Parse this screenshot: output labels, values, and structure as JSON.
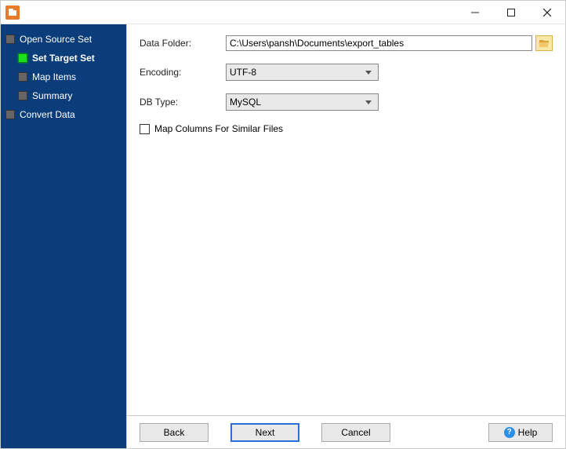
{
  "titlebar": {
    "title": ""
  },
  "sidebar": {
    "items": [
      {
        "label": "Open Source Set",
        "active": false,
        "indent": 0
      },
      {
        "label": "Set Target Set",
        "active": true,
        "indent": 1
      },
      {
        "label": "Map Items",
        "active": false,
        "indent": 1
      },
      {
        "label": "Summary",
        "active": false,
        "indent": 1
      },
      {
        "label": "Convert Data",
        "active": false,
        "indent": 0
      }
    ]
  },
  "form": {
    "data_folder_label": "Data Folder:",
    "data_folder_value": "C:\\Users\\pansh\\Documents\\export_tables",
    "encoding_label": "Encoding:",
    "encoding_value": "UTF-8",
    "dbtype_label": "DB Type:",
    "dbtype_value": "MySQL",
    "map_columns_label": "Map Columns For Similar Files",
    "map_columns_checked": false
  },
  "buttons": {
    "back": "Back",
    "next": "Next",
    "cancel": "Cancel",
    "help": "Help"
  }
}
